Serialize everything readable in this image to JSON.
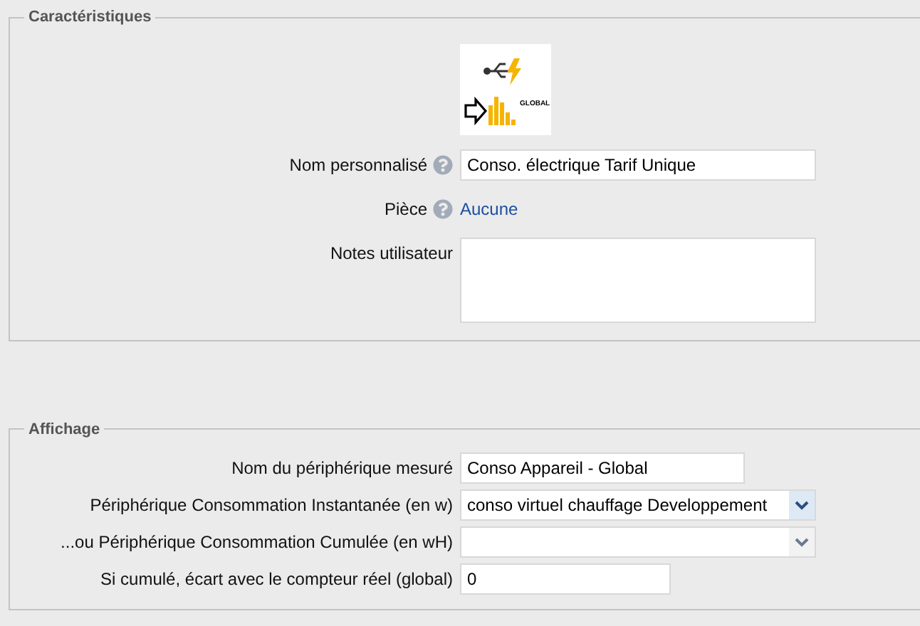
{
  "sections": [
    {
      "legend": "Caractéristiques",
      "image": {
        "caption": "GLOBAL"
      },
      "rows": [
        {
          "kind": "text",
          "label": "Nom personnalisé",
          "help": true,
          "value": "Conso. électrique Tarif Unique"
        },
        {
          "kind": "link",
          "label": "Pièce",
          "help": true,
          "value": "Aucune"
        },
        {
          "kind": "textarea",
          "label": "Notes utilisateur",
          "help": false,
          "value": ""
        }
      ]
    },
    {
      "legend": "Affichage",
      "rows": [
        {
          "kind": "text",
          "label": "Nom du périphérique mesuré",
          "help": false,
          "value": "Conso Appareil - Global"
        },
        {
          "kind": "select",
          "label": "Périphérique Consommation Instantanée (en w)",
          "help": false,
          "value": "conso virtuel chauffage Developpement",
          "focused": true
        },
        {
          "kind": "select",
          "label": "...ou Périphérique Consommation Cumulée (en wH)",
          "help": false,
          "value": "",
          "focused": false
        },
        {
          "kind": "number",
          "label": "Si cumulé, écart avec le compteur réel (global)",
          "help": false,
          "value": "0"
        }
      ]
    }
  ]
}
